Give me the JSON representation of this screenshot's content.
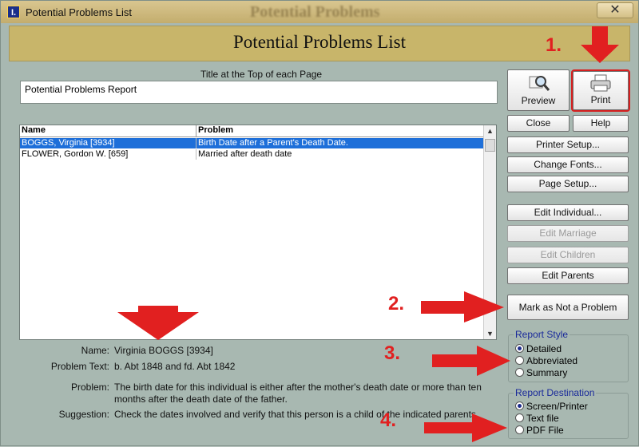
{
  "window": {
    "title": "Potential Problems List",
    "ghost_title": "Potential Problems",
    "close_glyph": "✕",
    "app_icon_text": "I."
  },
  "banner": {
    "title": "Potential Problems List"
  },
  "page_title_section": {
    "label": "Title at the Top of each Page",
    "value": "Potential Problems Report"
  },
  "list": {
    "columns": [
      "Name",
      "Problem"
    ],
    "rows": [
      {
        "name": "BOGGS, Virginia [3934]",
        "problem": "Birth Date after a Parent's Death Date.",
        "selected": true
      },
      {
        "name": "FLOWER, Gordon W. [659]",
        "problem": "Married after death date",
        "selected": false
      }
    ]
  },
  "buttons": {
    "preview": "Preview",
    "print": "Print",
    "close": "Close",
    "help": "Help",
    "printer_setup": "Printer Setup...",
    "change_fonts": "Change Fonts...",
    "page_setup": "Page Setup...",
    "edit_individual": "Edit Individual...",
    "edit_marriage": "Edit Marriage",
    "edit_children": "Edit Children",
    "edit_parents": "Edit Parents",
    "mark_not_problem": "Mark as Not a Problem"
  },
  "report_style": {
    "title": "Report Style",
    "options": [
      "Detailed",
      "Abbreviated",
      "Summary"
    ],
    "selected": "Detailed"
  },
  "report_destination": {
    "title": "Report Destination",
    "options": [
      "Screen/Printer",
      "Text file",
      "PDF File"
    ],
    "selected": "Screen/Printer"
  },
  "details": {
    "name_label": "Name:",
    "name_value": "Virginia BOGGS [3934]",
    "problem_text_label": "Problem Text:",
    "problem_text_value": "b. Abt 1848 and fd. Abt 1842",
    "problem_label": "Problem:",
    "problem_value_line1": "The birth date for this individual is either after the mother's death date or more than ten",
    "problem_value_line2": "months after the death date of the father.",
    "suggestion_label": "Suggestion:",
    "suggestion_value": "Check the dates involved and verify that this person is a child of the indicated parents."
  },
  "annotations": {
    "step1": "1.",
    "step2": "2.",
    "step3": "3.",
    "step4": "4.",
    "arrow_color": "#e12020"
  },
  "colors": {
    "window_bg": "#a8b8b1",
    "banner_bg": "#c8b56a",
    "selection": "#1e6fd9",
    "group_title": "#1a2a9a"
  }
}
